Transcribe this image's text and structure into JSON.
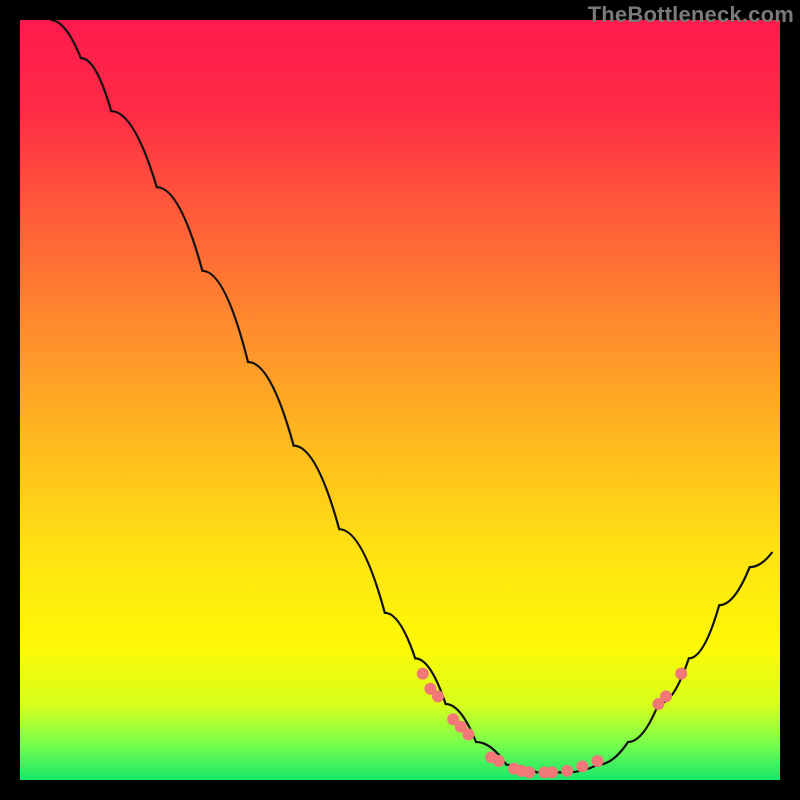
{
  "watermark": "TheBottleneck.com",
  "chart_data": {
    "type": "line",
    "title": "",
    "xlabel": "",
    "ylabel": "",
    "xlim": [
      0,
      100
    ],
    "ylim": [
      0,
      100
    ],
    "grid": false,
    "legend": false,
    "curve": [
      {
        "x": 4,
        "y": 100
      },
      {
        "x": 8,
        "y": 95
      },
      {
        "x": 12,
        "y": 88
      },
      {
        "x": 18,
        "y": 78
      },
      {
        "x": 24,
        "y": 67
      },
      {
        "x": 30,
        "y": 55
      },
      {
        "x": 36,
        "y": 44
      },
      {
        "x": 42,
        "y": 33
      },
      {
        "x": 48,
        "y": 22
      },
      {
        "x": 52,
        "y": 16
      },
      {
        "x": 56,
        "y": 10
      },
      {
        "x": 60,
        "y": 5
      },
      {
        "x": 64,
        "y": 2
      },
      {
        "x": 68,
        "y": 1
      },
      {
        "x": 72,
        "y": 1
      },
      {
        "x": 76,
        "y": 2
      },
      {
        "x": 80,
        "y": 5
      },
      {
        "x": 84,
        "y": 10
      },
      {
        "x": 88,
        "y": 16
      },
      {
        "x": 92,
        "y": 23
      },
      {
        "x": 96,
        "y": 28
      },
      {
        "x": 99,
        "y": 30
      }
    ],
    "markers": [
      {
        "x": 53,
        "y": 14
      },
      {
        "x": 54,
        "y": 12
      },
      {
        "x": 55,
        "y": 11
      },
      {
        "x": 57,
        "y": 8
      },
      {
        "x": 58,
        "y": 7
      },
      {
        "x": 59,
        "y": 6
      },
      {
        "x": 62,
        "y": 3
      },
      {
        "x": 63,
        "y": 2.5
      },
      {
        "x": 65,
        "y": 1.5
      },
      {
        "x": 66,
        "y": 1.2
      },
      {
        "x": 67,
        "y": 1
      },
      {
        "x": 69,
        "y": 1
      },
      {
        "x": 70,
        "y": 1
      },
      {
        "x": 72,
        "y": 1.2
      },
      {
        "x": 74,
        "y": 1.8
      },
      {
        "x": 76,
        "y": 2.5
      },
      {
        "x": 84,
        "y": 10
      },
      {
        "x": 85,
        "y": 11
      },
      {
        "x": 87,
        "y": 14
      }
    ],
    "gradient_stops": [
      {
        "offset": 0.0,
        "color": "#ff1a4d"
      },
      {
        "offset": 0.12,
        "color": "#ff2b46"
      },
      {
        "offset": 0.25,
        "color": "#ff5a3a"
      },
      {
        "offset": 0.4,
        "color": "#ff8a2e"
      },
      {
        "offset": 0.55,
        "color": "#ffb81f"
      },
      {
        "offset": 0.7,
        "color": "#ffe212"
      },
      {
        "offset": 0.82,
        "color": "#fff806"
      },
      {
        "offset": 0.9,
        "color": "#d8ff1a"
      },
      {
        "offset": 0.95,
        "color": "#7cff4a"
      },
      {
        "offset": 1.0,
        "color": "#17e86b"
      }
    ],
    "curve_color": "#111111",
    "marker_color": "#f27878",
    "marker_radius": 6
  }
}
